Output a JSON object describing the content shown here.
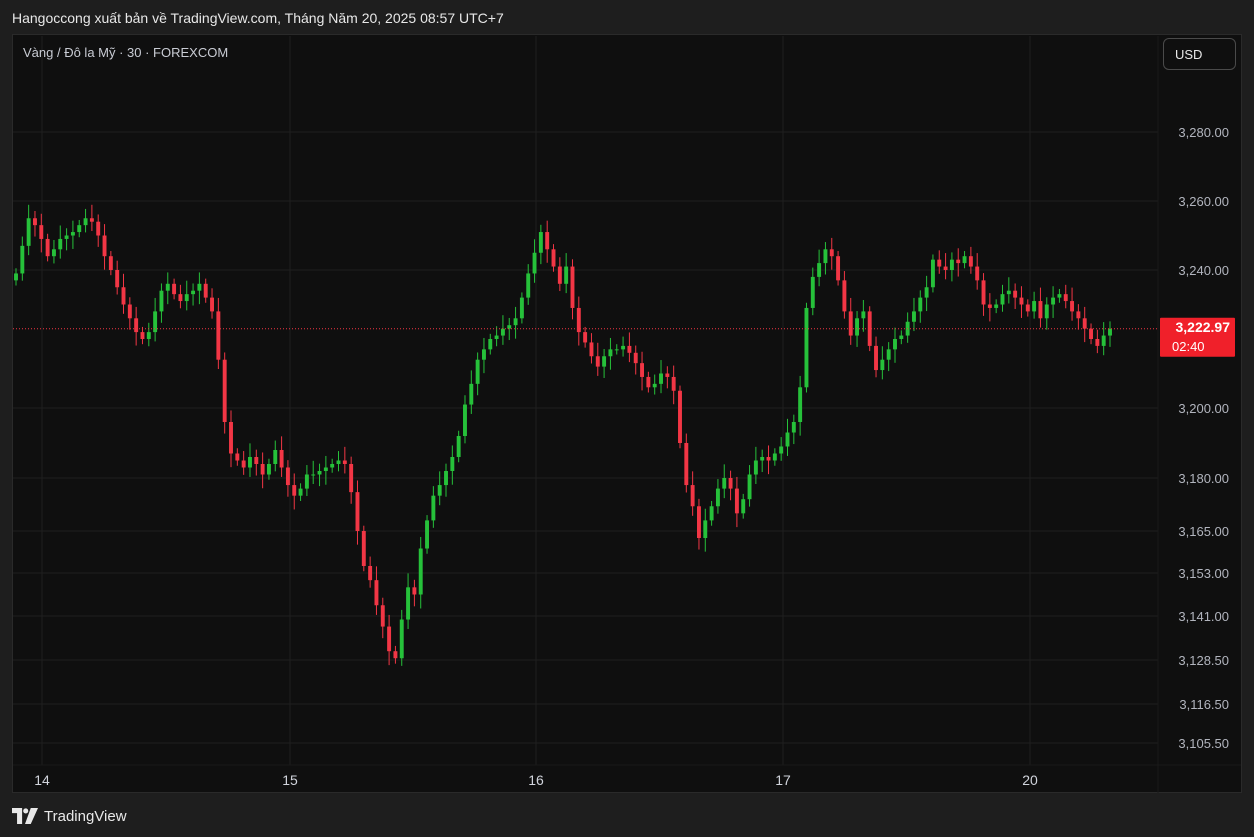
{
  "header": {
    "title": "Hangoccong xuất bản về TradingView.com, Tháng Năm 20, 2025 08:57 UTC+7"
  },
  "chart_header": {
    "symbol": "Vàng / Đô la Mỹ · 30 · FOREXCOM",
    "currency": "USD"
  },
  "footer": {
    "brand": "TradingView"
  },
  "colors": {
    "up": "#26c13a",
    "down": "#f23645",
    "background": "#0f0f0f",
    "grid": "#1f1f1f",
    "price_tag": "#f0202a"
  },
  "chart_data": {
    "type": "candlestick",
    "title": "Vàng / Đô la Mỹ · 30 · FOREXCOM",
    "ylabel": "USD",
    "y_ticks": [
      "3,280.00",
      "3,260.00",
      "3,240.00",
      "3,200.00",
      "3,180.00",
      "3,165.00",
      "3,153.00",
      "3,141.00",
      "3,128.50",
      "3,116.50",
      "3,105.50"
    ],
    "x_ticks": [
      "14",
      "15",
      "16",
      "17",
      "20"
    ],
    "last_price": "3,222.97",
    "countdown": "02:40",
    "series": [
      {
        "name": "Vàng / Đô la Mỹ",
        "values": [
          3239,
          3247,
          3255,
          3253,
          3249,
          3244,
          3246,
          3249,
          3250,
          3251,
          3253,
          3255,
          3254,
          3250,
          3244,
          3240,
          3235,
          3230,
          3226,
          3222,
          3220,
          3222,
          3228,
          3234,
          3236,
          3233,
          3231,
          3233,
          3234,
          3236,
          3232,
          3228,
          3214,
          3196,
          3187,
          3185,
          3183,
          3186,
          3184,
          3181,
          3184,
          3188,
          3183,
          3178,
          3175,
          3177,
          3181,
          3181,
          3182,
          3183,
          3184,
          3185,
          3184,
          3176,
          3165,
          3155,
          3151,
          3144,
          3138,
          3131,
          3129,
          3140,
          3149,
          3147,
          3160,
          3168,
          3175,
          3178,
          3182,
          3186,
          3192,
          3201,
          3207,
          3214,
          3217,
          3220,
          3221,
          3223,
          3224,
          3226,
          3232,
          3239,
          3245,
          3251,
          3246,
          3241,
          3236,
          3241,
          3229,
          3222,
          3219,
          3215,
          3212,
          3215,
          3217,
          3217,
          3218,
          3216,
          3213,
          3209,
          3206,
          3207,
          3210,
          3209,
          3205,
          3190,
          3178,
          3172,
          3163,
          3168,
          3172,
          3177,
          3180,
          3177,
          3170,
          3174,
          3181,
          3185,
          3186,
          3185,
          3187,
          3189,
          3193,
          3196,
          3206,
          3229,
          3238,
          3242,
          3246,
          3244,
          3237,
          3228,
          3221,
          3226,
          3228,
          3218,
          3211,
          3214,
          3217,
          3220,
          3221,
          3225,
          3228,
          3232,
          3235,
          3243,
          3241,
          3240,
          3243,
          3242,
          3244,
          3241,
          3237,
          3230,
          3229,
          3230,
          3233,
          3234,
          3232,
          3230,
          3228,
          3231,
          3226,
          3230,
          3232,
          3233,
          3231,
          3228,
          3226,
          3223,
          3220,
          3218,
          3221,
          3223
        ]
      }
    ]
  }
}
